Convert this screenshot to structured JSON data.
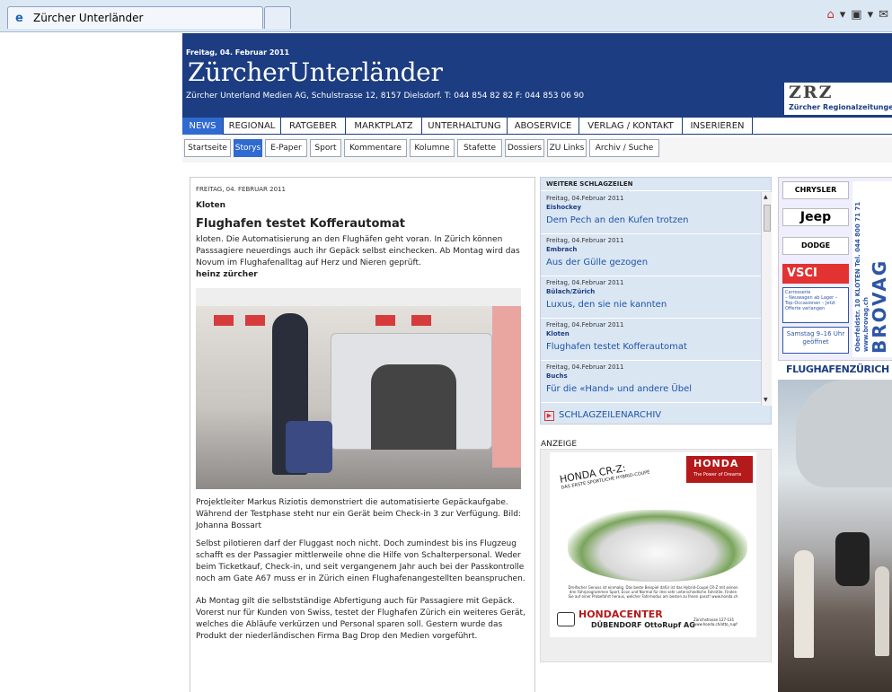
{
  "browser": {
    "tab_title": "Zürcher Unterländer"
  },
  "masthead": {
    "date": "Freitag, 04. Februar 2011",
    "title": "ZürcherUnterländer",
    "address": "Zürcher Unterland Medien AG, Schulstrasse 12, 8157 Dielsdorf. T: 044 854 82 82  F: 044 853 06 90",
    "logo_big": "ZRZ",
    "logo_small": "Zürcher Regionalzeitungen"
  },
  "nav": {
    "items": [
      "NEWS",
      "REGIONAL",
      "RATGEBER",
      "MARKTPLATZ",
      "UNTERHALTUNG",
      "ABOSERVICE",
      "VERLAG / KONTAKT",
      "INSERIEREN"
    ],
    "active": "NEWS"
  },
  "subnav": {
    "items": [
      "Startseite",
      "Storys",
      "E-Paper",
      "Sport",
      "Kommentare",
      "Kolumne",
      "Stafette",
      "Dossiers",
      "ZU Links",
      "Archiv / Suche"
    ],
    "active": "Storys"
  },
  "article": {
    "date": "FREITAG, 04. FEBRUAR 2011",
    "location": "Kloten",
    "title": "Flughafen testet Kofferautomat",
    "lead": "kloten. Die Automatisierung an den Flughäfen geht voran. In Zürich können Passsagiere neuerdings auch ihr Gepäck selbst einchecken. Ab Montag wird das Novum im Flughafenalltag auf Herz und Nieren geprüft.",
    "author": "heinz zürcher",
    "caption": "Projektleiter Markus Riziotis demonstriert die automatisierte Gepäckaufgabe. Während der Testphase steht nur ein Gerät beim Check-in 3 zur Verfügung. Bild: Johanna Bossart",
    "body1": "Selbst pilotieren darf der Fluggast noch nicht. Doch zumindest bis ins Flugzeug schafft es der Passagier mittlerweile ohne die Hilfe von Schalterpersonal. Weder beim Ticketkauf, Check-in, und seit vergangenem Jahr auch bei der Passkontrolle noch am Gate A67 muss er in Zürich einen Flughafenangestellten beanspruchen.",
    "body2": "Ab Montag gilt die selbstständige Abfertigung auch für Passagiere mit Gepäck. Vorerst nur für Kunden von Swiss, testet der Flughafen Zürich ein weiteres Gerät, welches die Abläufe verkürzen und Personal sparen soll. Gestern wurde das Produkt der niederländischen Firma Bag Drop den Medien vorgeführt."
  },
  "sidebar": {
    "heading": "WEITERE SCHLAGZEILEN",
    "items": [
      {
        "date": "Freitag, 04.Februar 2011",
        "category": "Eishockey",
        "title": "Dem Pech an den Kufen trotzen"
      },
      {
        "date": "Freitag, 04.Februar 2011",
        "category": "Embrach",
        "title": "Aus der Gülle gezogen"
      },
      {
        "date": "Freitag, 04.Februar 2011",
        "category": "Bülach/Zürich",
        "title": "Luxus, den sie nie kannten"
      },
      {
        "date": "Freitag, 04.Februar 2011",
        "category": "Kloten",
        "title": "Flughafen testet Kofferautomat"
      },
      {
        "date": "Freitag, 04.Februar 2011",
        "category": "Buchs",
        "title": "Für die «Hand» und andere Übel"
      }
    ],
    "archive_link": "SCHLAGZEILENARCHIV"
  },
  "ad": {
    "label": "ANZEIGE",
    "brand": "HONDA",
    "slogan": "The Power of Dreams",
    "model": "HONDA CR-Z:",
    "model_sub": "DAS ERSTE SPORTLICHE HYBRID-COUPÉ",
    "fine_print": "Dreifacher Genuss ist einmalig. Das beste Beispiel dafür ist das Hybrid-Coupé CR-Z mit seinen drei Fahrprogrammen Sport, Econ und Normal für drei sehr unterschiedliche Fahrstile. Finden Sie auf einer Probefahrt heraus, welcher Fahrmodus am besten zu Ihnen passt! www.honda.ch",
    "dealer": "HONDACENTER",
    "dealer_sub": "DÜBENDORF OttoRupf AG",
    "dealer_addr": "Zürichstrasse 127-131 www.honda.ch/otto_rupf"
  },
  "right_ad": {
    "brands": [
      "CHRYSLER",
      "Jeep",
      "DODGE"
    ],
    "vsci": "VSCI",
    "carrosserie": "Carrosserie",
    "bullets": "– Neuwagen ab Lager – Top-Occasionen – Jetzt Offerte verlangen",
    "hours": "Samstag 9–16 Uhr geöffnet",
    "address_vertical": "Oberfeldstr. 10 KLOTEN Tel. 044 800 71 71 www.brovag.ch",
    "brand_vertical": "BROVAG KLOTEN",
    "airport": "FLUGHAFENZÜRICH"
  }
}
